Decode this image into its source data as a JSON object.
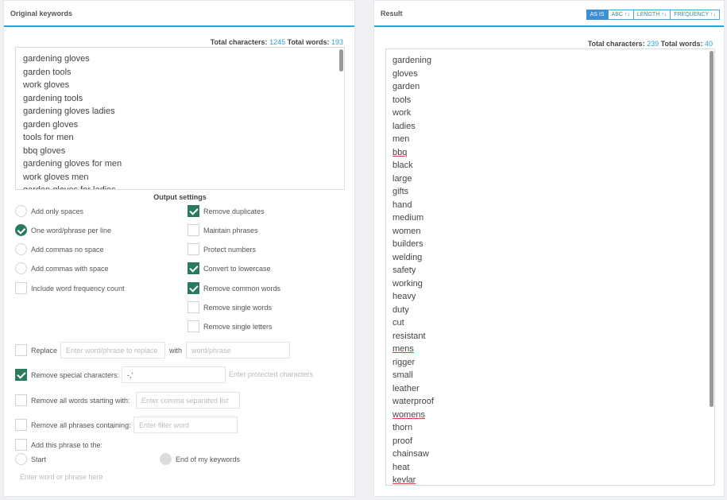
{
  "left": {
    "title": "Original keywords",
    "stats": {
      "chars_label": "Total characters:",
      "chars": "1245",
      "words_label": "Total words:",
      "words": "193"
    },
    "keywords": [
      "gardening gloves",
      "garden tools",
      "work gloves",
      "gardening tools",
      "gardening gloves ladies",
      "garden gloves",
      "tools for men",
      "bbq gloves",
      "gardening gloves for men",
      "work gloves men",
      "garden gloves for ladies"
    ],
    "output_settings_title": "Output settings",
    "options_left": [
      {
        "label": "Add only spaces",
        "checked": false
      },
      {
        "label": "One word/phrase per line",
        "checked": true
      },
      {
        "label": "Add commas no space",
        "checked": false
      },
      {
        "label": "Add commas with space",
        "checked": false
      },
      {
        "label": "Include word frequency count",
        "checked": false
      }
    ],
    "options_right": [
      {
        "label": "Remove duplicates",
        "checked": true
      },
      {
        "label": "Maintain phrases",
        "checked": false
      },
      {
        "label": "Protect numbers",
        "checked": false
      },
      {
        "label": "Convert to lowercase",
        "checked": true
      },
      {
        "label": "Remove common words",
        "checked": true
      },
      {
        "label": "Remove single words",
        "checked": false
      },
      {
        "label": "Remove single letters",
        "checked": false
      }
    ],
    "replace": {
      "label": "Replace",
      "placeholder1": "Enter word/phrase to replace",
      "with": "with",
      "placeholder2": "word/phrase"
    },
    "special": {
      "label": "Remove special characters:",
      "value": "-,'",
      "protected_placeholder": "Enter protected characters"
    },
    "starting": {
      "label": "Remove all words starting with:",
      "placeholder": "Enter comma separated list"
    },
    "containing": {
      "label": "Remove all phrases containing:",
      "placeholder": "Enter filter word"
    },
    "add_phrase": {
      "label": "Add this phrase to the:",
      "start": "Start",
      "end": "End of my keywords",
      "placeholder": "Enter word or phrase here"
    }
  },
  "right": {
    "title": "Result",
    "sort": [
      "AS IS",
      "ABC ↑↓",
      "LENGTH ↑↓",
      "FREQUENCY ↑↓"
    ],
    "stats": {
      "chars_label": "Total characters:",
      "chars": "239",
      "words_label": "Total words:",
      "words": "40"
    },
    "results": [
      "gardening",
      "gloves",
      "garden",
      "tools",
      "work",
      "ladies",
      "men",
      "bbq",
      "black",
      "large",
      "gifts",
      "hand",
      "medium",
      "women",
      "builders",
      "welding",
      "safety",
      "working",
      "heavy",
      "duty",
      "cut",
      "resistant",
      "mens",
      "rigger",
      "small",
      "leather",
      "waterproof",
      "womens",
      "thorn",
      "proof",
      "chainsaw",
      "heat",
      "kevlar"
    ],
    "misspelled": [
      "bbq",
      "mens",
      "womens",
      "kevlar"
    ]
  }
}
